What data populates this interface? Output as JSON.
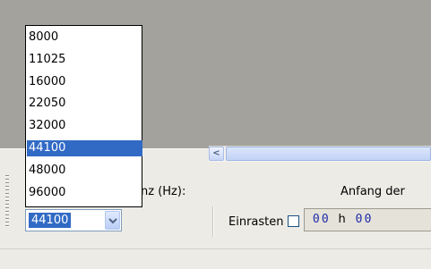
{
  "sample_rate": {
    "label": "nz (Hz):",
    "current_value": "44100",
    "options": [
      "8000",
      "11025",
      "16000",
      "22050",
      "32000",
      "44100",
      "48000",
      "96000"
    ],
    "highlighted_option": "44100"
  },
  "selection": {
    "start_label": "Anfang der",
    "snap_label": "Einrasten",
    "snap_checked": false,
    "time_digits": [
      "0",
      "0",
      "0",
      "0"
    ],
    "hours_unit": "h"
  },
  "icons": {
    "combo_arrow": "chevron-down-icon",
    "scroll_left": "arrow-left-icon"
  },
  "colors": {
    "selection_blue": "#316ac5",
    "workspace_gray": "#a3a29c",
    "toolbar_bg": "#ecebe6",
    "time_digit_blue": "#1f28a8"
  }
}
